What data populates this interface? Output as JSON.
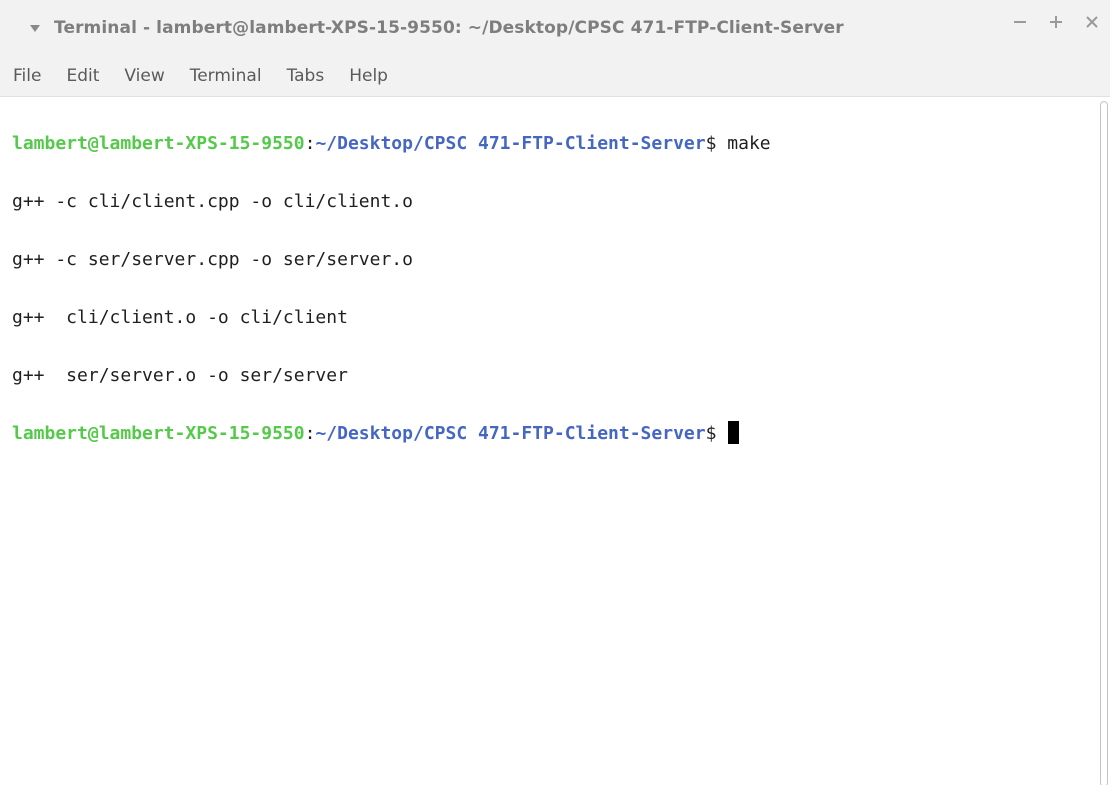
{
  "window": {
    "title": "Terminal - lambert@lambert-XPS-15-9550: ~/Desktop/CPSC 471-FTP-Client-Server",
    "controls": [
      "minimize-icon",
      "maximize-icon",
      "close-icon"
    ]
  },
  "menu": {
    "items": [
      "File",
      "Edit",
      "View",
      "Terminal",
      "Tabs",
      "Help"
    ]
  },
  "terminal": {
    "prompt_user": "lambert@lambert-XPS-15-9550",
    "prompt_path": "~/Desktop/CPSC 471-FTP-Client-Server",
    "prompt_symbol": "$ ",
    "command": "make",
    "output": [
      "g++ -c cli/client.cpp -o cli/client.o",
      "g++ -c ser/server.cpp -o ser/server.o",
      "g++  cli/client.o -o cli/client",
      "g++  ser/server.o -o ser/server"
    ]
  },
  "colors": {
    "prompt_user": "#55c94a",
    "prompt_path": "#4666c4",
    "text": "#1f1f1f",
    "chrome_bg": "#f2f2f2"
  }
}
